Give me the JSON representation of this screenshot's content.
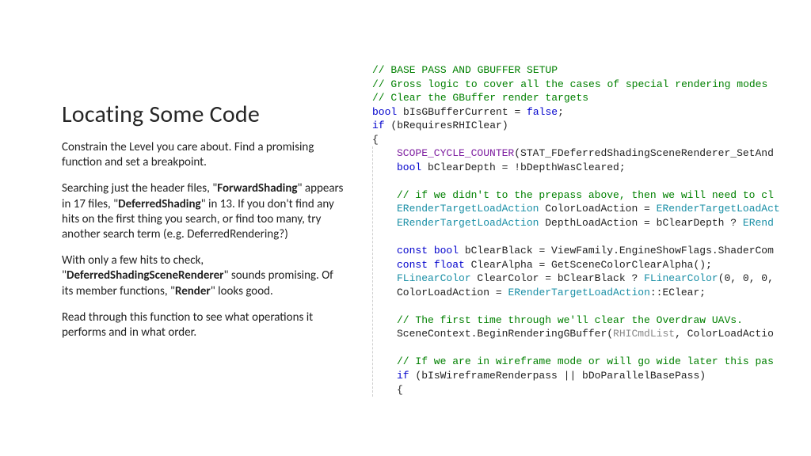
{
  "title": "Locating Some Code",
  "para1": "Constrain the Level you care about. Find a promising function and set a breakpoint.",
  "para2_a": "Searching just the header files, \"",
  "para2_b1": "ForwardShading",
  "para2_c": "\" appears in 17 files, \"",
  "para2_b2": "DeferredShading",
  "para2_d": "\" in 13. If you don't find any hits on the first thing you search, or find too many, try another search term (e.g. DeferredRendering?)",
  "para3_a": "With only a few hits to check, \"",
  "para3_b1": "DeferredShadingSceneRenderer",
  "para3_c": "\" sounds promising. Of its member functions, \"",
  "para3_b2": "Render",
  "para3_d": "\" looks good.",
  "para4": "Read through this function to see what operations it performs and in what order.",
  "code": {
    "c1": "// BASE PASS AND GBUFFER SETUP",
    "c2": "// Gross logic to cover all the cases of special rendering modes ",
    "c3": "// Clear the GBuffer render targets",
    "l4a": "bool",
    "l4b": " bIsGBufferCurrent = ",
    "l4c": "false",
    "l4d": ";",
    "l5a": "if",
    "l5b": " (bRequiresRHIClear)",
    "l6": "{",
    "l7a": "SCOPE_CYCLE_COUNTER",
    "l7b": "(STAT_FDeferredShadingSceneRenderer_SetAnd",
    "l8a": "bool",
    "l8b": " bClearDepth = !bDepthWasCleared;",
    "c9": "// if we didn't to the prepass above, then we will need to cl",
    "l10a": "ERenderTargetLoadAction",
    "l10b": " ColorLoadAction = ",
    "l10c": "ERenderTargetLoadAct",
    "l11a": "ERenderTargetLoadAction",
    "l11b": " DepthLoadAction = bClearDepth ? ",
    "l11c": "ERend",
    "l12a": "const",
    "l12b": " bool",
    "l12c": " bClearBlack = ViewFamily.EngineShowFlags.ShaderCom",
    "l13a": "const",
    "l13b": " float",
    "l13c": " ClearAlpha = GetSceneColorClearAlpha();",
    "l14a": "FLinearColor",
    "l14b": " ClearColor = bClearBlack ? ",
    "l14c": "FLinearColor",
    "l14d": "(0, 0, 0,",
    "l15a": "ColorLoadAction = ",
    "l15b": "ERenderTargetLoadAction",
    "l15c": "::EClear;",
    "c16": "// The first time through we'll clear the Overdraw UAVs.",
    "l17a": "SceneContext.BeginRenderingGBuffer(",
    "l17b": "RHICmdList",
    "l17c": ", ColorLoadActio",
    "c18": "// If we are in wireframe mode or will go wide later this pas",
    "l19a": "if",
    "l19b": " (bIsWireframeRenderpass || bDoParallelBasePass)",
    "l20": "{"
  }
}
